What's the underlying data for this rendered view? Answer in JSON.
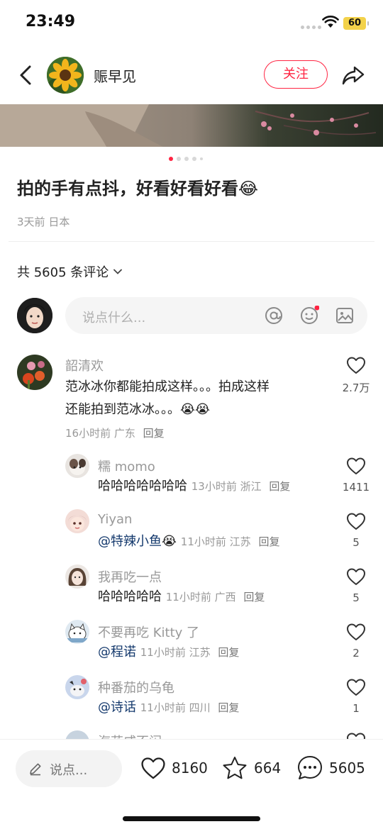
{
  "status_bar": {
    "time": "23:49",
    "battery": "60"
  },
  "header": {
    "author_name": "赈早见",
    "follow_label": "关注"
  },
  "post": {
    "title": "拍的手有点抖，好看好看好看",
    "title_emoji": "😂",
    "time": "3天前",
    "location": "日本",
    "pager": {
      "total": 5,
      "active": 1
    }
  },
  "comments_header": {
    "label": "共 5605 条评论"
  },
  "comment_input": {
    "placeholder": "说点什么..."
  },
  "comments": [
    {
      "user": "韶清欢",
      "text_line1": "范冰冰你都能拍成这样。。。拍成这样",
      "text_line2": "还能拍到范冰冰。。。",
      "emoji": "😭😭",
      "time": "16小时前",
      "location": "广东",
      "reply": "回复",
      "likes": "2.7万"
    }
  ],
  "replies": [
    {
      "user": "糯 momo",
      "mention": "",
      "text": "哈哈哈哈哈哈哈",
      "emoji": "",
      "time": "13小时前",
      "location": "浙江",
      "reply": "回复",
      "likes": "1411"
    },
    {
      "user": "Yiyan",
      "mention": "@特辣小鱼",
      "text": "",
      "emoji": "😭",
      "time": "11小时前",
      "location": "江苏",
      "reply": "回复",
      "likes": "5"
    },
    {
      "user": "我再吃一点",
      "mention": "",
      "text": "哈哈哈哈哈",
      "emoji": "",
      "time": "11小时前",
      "location": "广西",
      "reply": "回复",
      "likes": "5"
    },
    {
      "user": "不要再吃 Kitty 了",
      "mention": "@程诺",
      "text": "",
      "emoji": "",
      "time": "11小时前",
      "location": "江苏",
      "reply": "回复",
      "likes": "2"
    },
    {
      "user": "种番茄的乌龟",
      "mention": "@诗话",
      "text": "",
      "emoji": "",
      "time": "11小时前",
      "location": "四川",
      "reply": "回复",
      "likes": "1"
    },
    {
      "user": "海花咸不闲",
      "mention": "",
      "text": "",
      "emoji": "",
      "time": "",
      "location": "",
      "reply": "",
      "likes": ""
    }
  ],
  "bottom_bar": {
    "input_placeholder": "说点...",
    "likes": "8160",
    "favorites": "664",
    "comments": "5605"
  },
  "colors": {
    "accent": "#ff2442",
    "mention": "#13386c"
  }
}
